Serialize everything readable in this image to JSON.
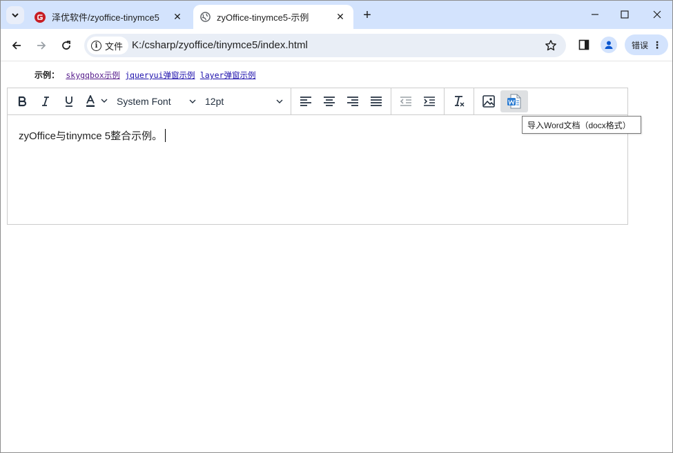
{
  "browser": {
    "tabs": [
      {
        "title": "泽优软件/zyoffice-tinymce5",
        "active": false
      },
      {
        "title": "zyOffice-tinymce5-示例",
        "active": true
      }
    ],
    "new_tab_label": "+",
    "site_chip_label": "文件",
    "url": "K:/csharp/zyoffice/tinymce5/index.html",
    "error_button_label": "错误"
  },
  "page": {
    "examples_label": "示例：",
    "links": [
      {
        "label": "skygqbox示例"
      },
      {
        "label": "jqueryui弹窗示例"
      },
      {
        "label": "layer弹窗示例"
      }
    ]
  },
  "editor": {
    "font_family": "System Font",
    "font_size": "12pt",
    "content_text": "zyOffice与tinymce 5整合示例。",
    "tooltip": "导入Word文档（docx格式）"
  },
  "colors": {
    "tab_strip": "#d3e3fd",
    "omnibox": "#e9eef6",
    "editor_border": "#cccccc",
    "link": "#1a0dab",
    "word_icon": "#2b7cd3"
  }
}
